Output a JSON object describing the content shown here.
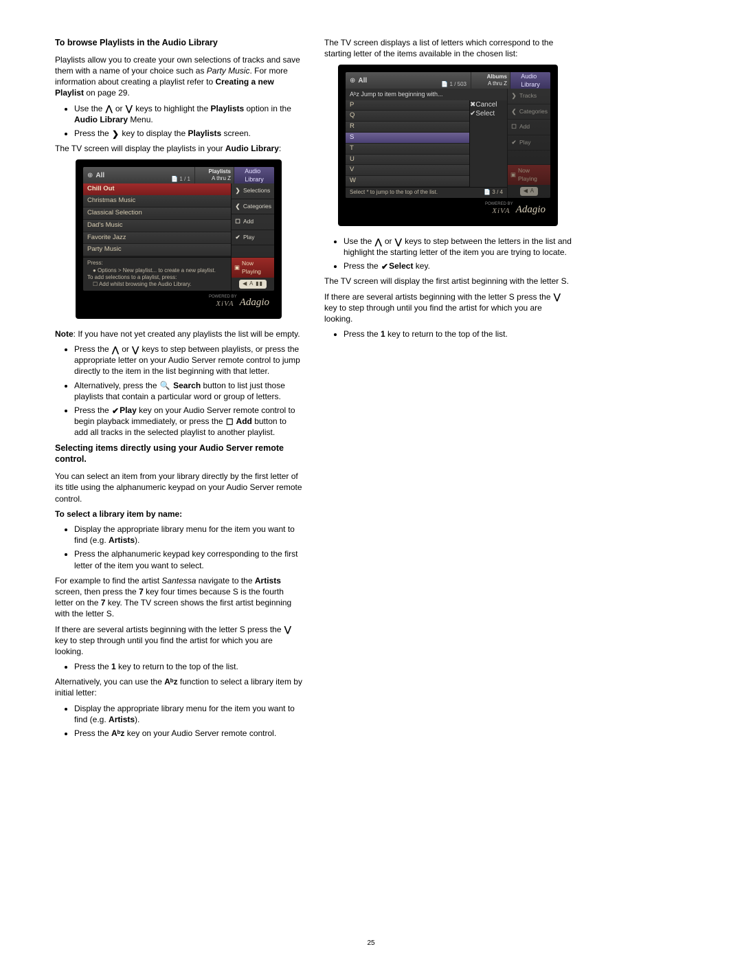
{
  "page_number": "25",
  "icons": {
    "up": "⋀",
    "down": "⋁",
    "right": "❯",
    "left": "❮",
    "search": "🔍",
    "check": "✔",
    "mark": "☐",
    "x": "✖",
    "atoz": "Aᵇz"
  },
  "left": {
    "h1": "To browse Playlists in the Audio Library",
    "p1a": "Playlists allow you to create your own selections of tracks and save them with a name of your choice such as ",
    "p1b": "Party Music",
    "p1c": ".  For more information about creating a playlist refer to ",
    "p1d": "Creating a new Playlist",
    "p1e": " on page 29.",
    "b1a": "Use the ",
    "b1b": " or ",
    "b1c": " keys to highlight the ",
    "b1d": "Playlists",
    "b1e": " option in the ",
    "b1f": "Audio Library",
    "b1g": " Menu.",
    "b2a": "Press the ",
    "b2b": " key to display the ",
    "b2c": "Playlists",
    "b2d": " screen.",
    "p2a": "The TV screen will display the playlists in your ",
    "p2b": "Audio Library",
    "p2c": ":",
    "note_a": "Note",
    "note_b": ": If you have not yet created any playlists the list will be empty.",
    "b3a": "Press the ",
    "b3b": " or ",
    "b3c": " keys to step between playlists, or press the appropriate letter on your Audio Server remote control to jump directly to the item in the list beginning with that letter.",
    "b4a": "Alternatively, press the ",
    "b4b": " Search",
    "b4c": " button to list just those playlists that contain a particular word or group of letters.",
    "b5a": "Press the ",
    "b5b": "Play",
    "b5c": " key on your Audio Server remote control to begin playback immediately, or press the ",
    "b5d": " Add",
    "b5e": " button to add all tracks in the selected playlist to another playlist.",
    "h2": "Selecting items directly using your Audio Server remote control.",
    "p3": "You can select an item from your library directly by the first letter of its title using the alphanumeric keypad on your Audio Server remote control.",
    "p4": "To select a library item by name:",
    "b6a": "Display the appropriate library menu for the item you want to find (e.g. ",
    "b6b": "Artists",
    "b6c": ").",
    "b7": "Press the alphanumeric keypad key corresponding to the first letter of the item you want to select.",
    "p5a": "For example to find the artist ",
    "p5b": "Santessa",
    "p5c": " navigate to the ",
    "p5d": "Artists",
    "p5e": " screen, then press the ",
    "p5f": "7",
    "p5g": " key four times because S is the fourth letter on the ",
    "p5h": "7",
    "p5i": " key.  The TV screen shows the first artist beginning with the letter S.",
    "p6a": "If there are several artists beginning with the letter S press the ",
    "p6b": " key to step through until you find the artist for which you are looking.",
    "b8a": "Press the ",
    "b8b": "1",
    "b8c": " key to return to the top of the list.",
    "p7a": "Alternatively, you can use the ",
    "p7b": " function to select a library item by initial letter:",
    "b9a": "Display the appropriate library menu for the item you want to find (e.g. ",
    "b9b": "Artists",
    "b9c": ").",
    "b10a": "Press the ",
    "b10b": " key on your Audio Server remote control."
  },
  "right": {
    "p1": "The TV screen displays a list of letters which correspond to the starting letter of the items available in the chosen list:",
    "b1a": "Use the ",
    "b1b": " or ",
    "b1c": " keys to step between the letters in the list and highlight the starting letter of the item you are trying to locate.",
    "b2a": "Press the ",
    "b2b": "Select",
    "b2c": " key.",
    "p2": "The TV screen will display the first artist beginning with the letter S.",
    "p3a": "If there are several artists beginning with the letter S press the ",
    "p3b": " key to step through until you find the artist for which you are looking.",
    "b3a": "Press the ",
    "b3b": "1",
    "b3c": " key to return to the top of the list."
  },
  "tv1": {
    "all": "All",
    "page": "📄 1 / 1",
    "mid_top": "Playlists",
    "mid_bot": "A thru Z",
    "lib": "Audio\nLibrary",
    "hdr": "Chill Out",
    "rows": [
      "Christmas Music",
      "Classical Selection",
      "Dad's Music",
      "Favorite Jazz",
      "Party Music"
    ],
    "press1": "Press:",
    "press2": "● Options > New playlist... to create a new playlist.",
    "press3": "To add selections to a playlist, press:",
    "press4": "☐ Add whilst browsing the Audio Library.",
    "side": {
      "selections": "Selections",
      "categories": "Categories",
      "add": "Add",
      "play": "Play",
      "np": "Now Playing",
      "ctl": "◀ A ▮▮"
    },
    "powered": "POWERED BY",
    "xiva": "XiVA",
    "adagio": "Adagio"
  },
  "tv2": {
    "all": "All",
    "page": "📄 1 / 503",
    "mid_top": "Albums",
    "mid_bot": "A thru Z",
    "lib": "Audio\nLibrary",
    "jump": "Aᵇz Jump to item beginning with...",
    "letters": [
      "P",
      "Q",
      "R",
      "S",
      "T",
      "U",
      "V",
      "W"
    ],
    "selected": "S",
    "hint_l": "Select * to jump to the top of the list.",
    "hint_r": "📄 3 / 4",
    "side": {
      "tracks": "Tracks",
      "categories": "Categories",
      "add": "Add",
      "play": "Play",
      "cancel": "Cancel",
      "select": "Select",
      "np": "Now Playing",
      "ctl": "◀ A"
    },
    "powered": "POWERED BY",
    "xiva": "XiVA",
    "adagio": "Adagio"
  }
}
